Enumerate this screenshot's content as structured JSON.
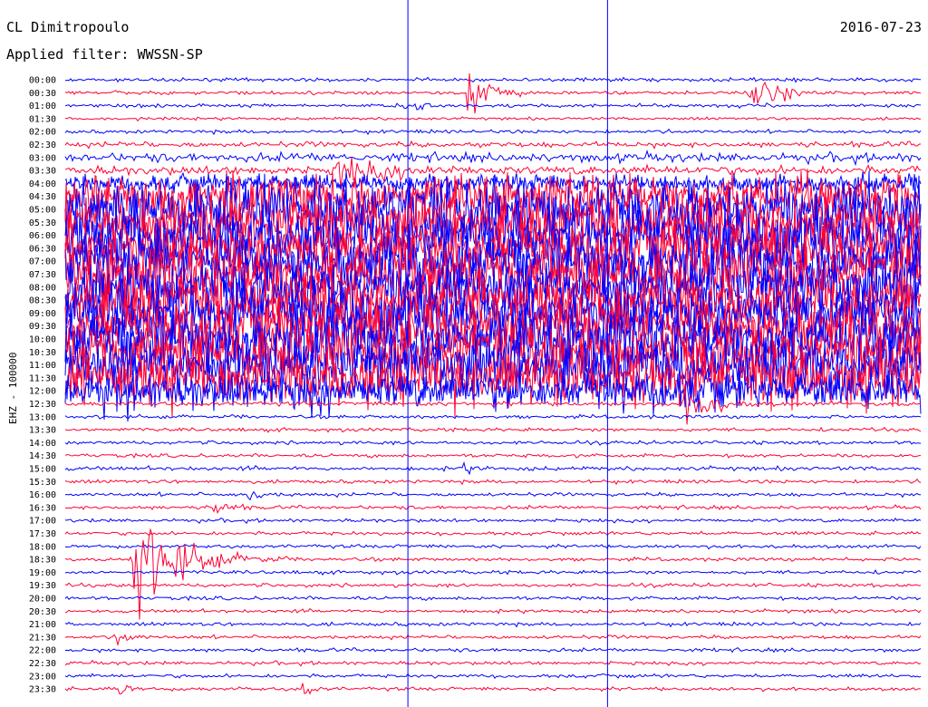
{
  "header": {
    "station": "CL Dimitropoulo",
    "filter": "Applied filter: WWSSN-SP",
    "date": "2016-07-23"
  },
  "chart_data": {
    "type": "line",
    "title": "CL Dimitropoulo",
    "subtitle": "Applied filter: WWSSN-SP",
    "date": "2016-07-23",
    "ylabel": "EHZ - 100000",
    "xlabel": "",
    "trace_colors": [
      "#0000ff",
      "#ff0033"
    ],
    "grid": false,
    "rows": [
      {
        "label": "00:00",
        "color": "#0000ff",
        "noise": 1.0
      },
      {
        "label": "00:30",
        "color": "#ff0033",
        "noise": 1.0
      },
      {
        "label": "01:00",
        "color": "#0000ff",
        "noise": 1.0
      },
      {
        "label": "01:30",
        "color": "#ff0033",
        "noise": 0.8
      },
      {
        "label": "02:00",
        "color": "#0000ff",
        "noise": 1.0
      },
      {
        "label": "02:30",
        "color": "#ff0033",
        "noise": 1.5
      },
      {
        "label": "03:00",
        "color": "#0000ff",
        "noise": 2.5
      },
      {
        "label": "03:30",
        "color": "#ff0033",
        "noise": 2.5
      },
      {
        "label": "04:00",
        "color": "#0000ff",
        "noise": 5
      },
      {
        "label": "04:30",
        "color": "#ff0033",
        "noise": 12
      },
      {
        "label": "05:00",
        "color": "#0000ff",
        "noise": 16
      },
      {
        "label": "05:30",
        "color": "#ff0033",
        "noise": 16
      },
      {
        "label": "06:00",
        "color": "#0000ff",
        "noise": 16
      },
      {
        "label": "06:30",
        "color": "#ff0033",
        "noise": 16
      },
      {
        "label": "07:00",
        "color": "#0000ff",
        "noise": 16
      },
      {
        "label": "07:30",
        "color": "#ff0033",
        "noise": 16
      },
      {
        "label": "08:00",
        "color": "#0000ff",
        "noise": 16
      },
      {
        "label": "08:30",
        "color": "#ff0033",
        "noise": 16
      },
      {
        "label": "09:00",
        "color": "#0000ff",
        "noise": 16
      },
      {
        "label": "09:30",
        "color": "#ff0033",
        "noise": 16
      },
      {
        "label": "10:00",
        "color": "#0000ff",
        "noise": 16
      },
      {
        "label": "10:30",
        "color": "#ff0033",
        "noise": 16
      },
      {
        "label": "11:00",
        "color": "#0000ff",
        "noise": 16
      },
      {
        "label": "11:30",
        "color": "#ff0033",
        "noise": 16
      },
      {
        "label": "12:00",
        "color": "#0000ff",
        "noise": 11
      },
      {
        "label": "12:30",
        "color": "#ff0033",
        "noise": 1.2
      },
      {
        "label": "13:00",
        "color": "#0000ff",
        "noise": 1.0
      },
      {
        "label": "13:30",
        "color": "#ff0033",
        "noise": 1.0
      },
      {
        "label": "14:00",
        "color": "#0000ff",
        "noise": 1.0
      },
      {
        "label": "14:30",
        "color": "#ff0033",
        "noise": 1.0
      },
      {
        "label": "15:00",
        "color": "#0000ff",
        "noise": 1.2
      },
      {
        "label": "15:30",
        "color": "#ff0033",
        "noise": 1.0
      },
      {
        "label": "16:00",
        "color": "#0000ff",
        "noise": 1.0
      },
      {
        "label": "16:30",
        "color": "#ff0033",
        "noise": 1.0
      },
      {
        "label": "17:00",
        "color": "#0000ff",
        "noise": 1.0
      },
      {
        "label": "17:30",
        "color": "#ff0033",
        "noise": 1.0
      },
      {
        "label": "18:00",
        "color": "#0000ff",
        "noise": 1.0
      },
      {
        "label": "18:30",
        "color": "#ff0033",
        "noise": 1.0
      },
      {
        "label": "19:00",
        "color": "#0000ff",
        "noise": 1.0
      },
      {
        "label": "19:30",
        "color": "#ff0033",
        "noise": 1.0
      },
      {
        "label": "20:00",
        "color": "#0000ff",
        "noise": 1.0
      },
      {
        "label": "20:30",
        "color": "#ff0033",
        "noise": 1.0
      },
      {
        "label": "21:00",
        "color": "#0000ff",
        "noise": 1.0
      },
      {
        "label": "21:30",
        "color": "#ff0033",
        "noise": 1.0
      },
      {
        "label": "22:00",
        "color": "#0000ff",
        "noise": 1.0
      },
      {
        "label": "22:30",
        "color": "#ff0033",
        "noise": 1.0
      },
      {
        "label": "23:00",
        "color": "#0000ff",
        "noise": 1.0
      },
      {
        "label": "23:30",
        "color": "#ff0033",
        "noise": 1.0
      }
    ],
    "events": [
      {
        "row": "00:30",
        "minute": 14.1,
        "amplitude": 24,
        "duration": 1.0
      },
      {
        "row": "00:30",
        "minute": 23.9,
        "amplitude": 14,
        "duration": 1.5
      },
      {
        "row": "01:00",
        "minute": 11.9,
        "amplitude": 5,
        "duration": 0.8
      },
      {
        "row": "03:30",
        "minute": 9.5,
        "amplitude": 9,
        "duration": 2.5
      },
      {
        "row": "12:30",
        "minute": 21.7,
        "amplitude": 16,
        "duration": 1.3
      },
      {
        "row": "15:00",
        "minute": 13.8,
        "amplitude": 5,
        "duration": 0.5
      },
      {
        "row": "16:00",
        "minute": 6.4,
        "amplitude": 6,
        "duration": 0.5
      },
      {
        "row": "16:30",
        "minute": 5.2,
        "amplitude": 9,
        "duration": 0.6
      },
      {
        "row": "18:30",
        "minute": 2.3,
        "amplitude": 40,
        "duration": 2.2
      },
      {
        "row": "21:30",
        "minute": 1.8,
        "amplitude": 9,
        "duration": 0.5
      },
      {
        "row": "23:30",
        "minute": 1.9,
        "amplitude": 8,
        "duration": 0.4
      },
      {
        "row": "23:30",
        "minute": 8.3,
        "amplitude": 5,
        "duration": 0.5
      }
    ]
  }
}
